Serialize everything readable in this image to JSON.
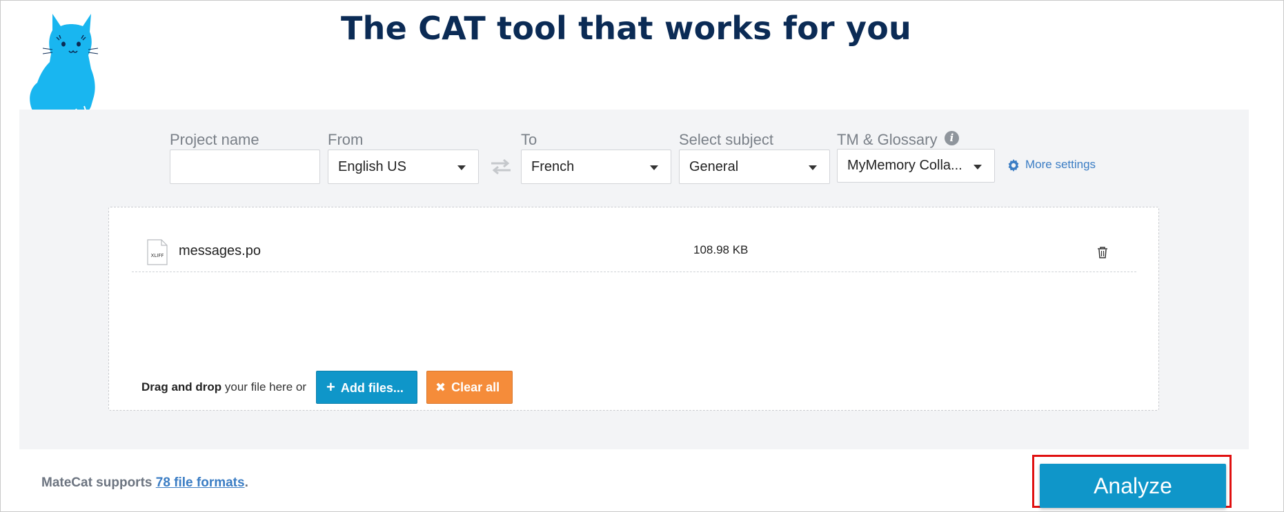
{
  "header": {
    "title": "The CAT tool that works for you"
  },
  "form": {
    "project_name": {
      "label": "Project name",
      "value": "",
      "placeholder": ""
    },
    "from": {
      "label": "From",
      "value": "English US"
    },
    "to": {
      "label": "To",
      "value": "French"
    },
    "subject": {
      "label": "Select subject",
      "value": "General"
    },
    "tm": {
      "label": "TM & Glossary",
      "value": "MyMemory Colla...",
      "info_icon": "i"
    },
    "more_settings": "More settings"
  },
  "files": [
    {
      "name": "messages.po",
      "size": "108.98 KB",
      "type_label": "XLIFF"
    }
  ],
  "dropzone": {
    "dnd_bold": "Drag and drop",
    "dnd_rest": " your file here or",
    "add_files": "Add files...",
    "clear_all": "Clear all"
  },
  "footer": {
    "support_prefix": "MateCat supports ",
    "support_link": "78 file formats",
    "support_suffix": ".",
    "analyze": "Analyze"
  },
  "colors": {
    "accent": "#0f96c9",
    "clear": "#f58c3a",
    "title": "#0b2b55",
    "highlight": "#e01010"
  }
}
